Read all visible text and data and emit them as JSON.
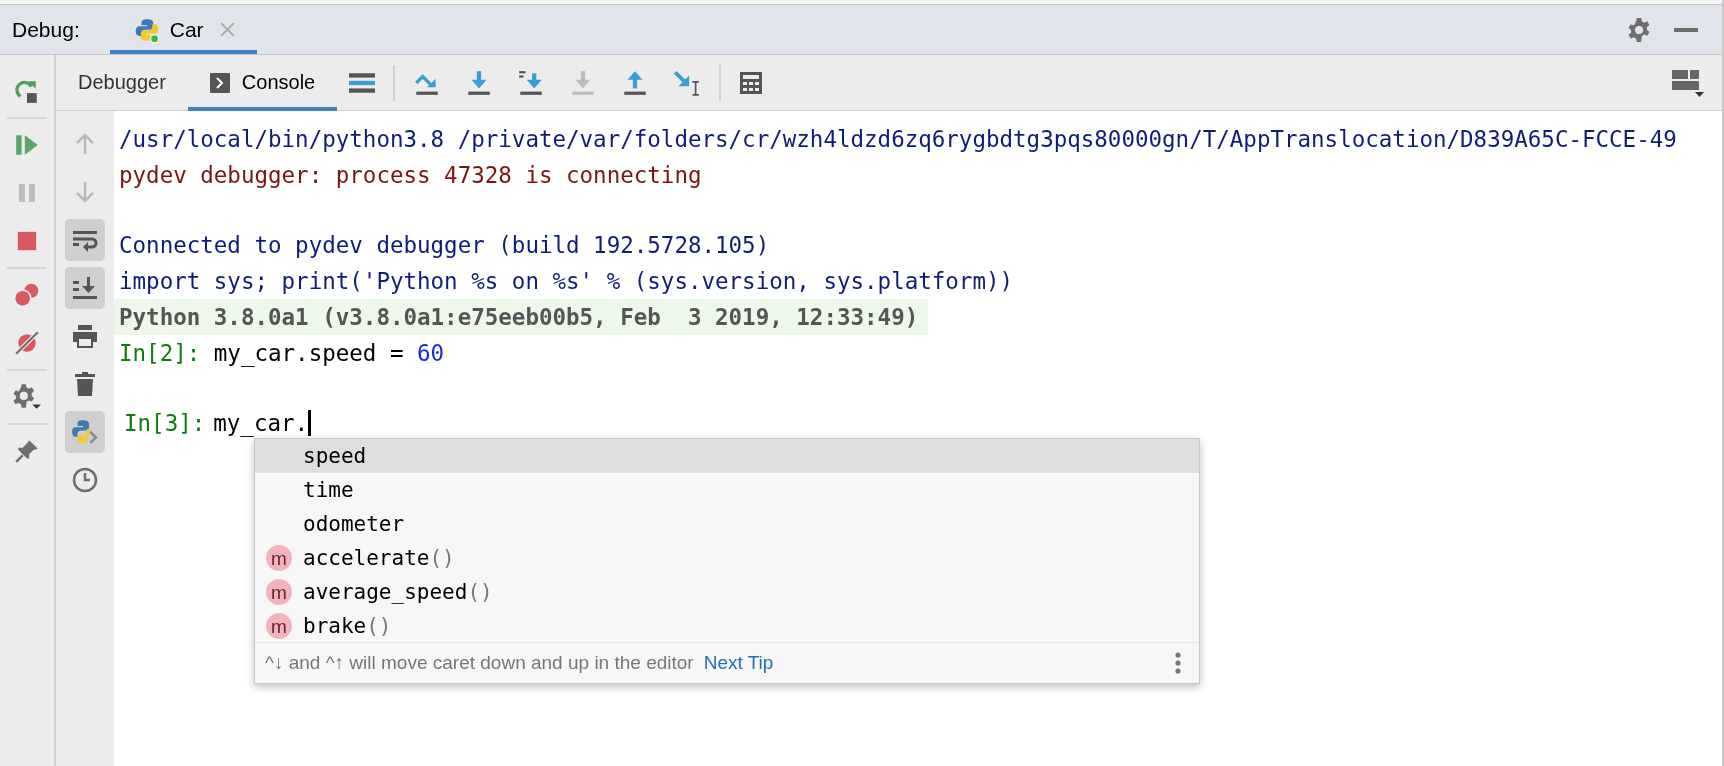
{
  "debug_bar": {
    "label": "Debug:",
    "tab": {
      "title": "Car",
      "selected": true
    }
  },
  "panel_tabs": [
    {
      "label": "Debugger",
      "kind": "plain",
      "selected": false
    },
    {
      "label": "Console",
      "kind": "console",
      "selected": true
    }
  ],
  "step_buttons": [
    {
      "kind": "step-over",
      "disabled": false
    },
    {
      "kind": "step-into",
      "disabled": false
    },
    {
      "kind": "step-into-my-code",
      "disabled": false
    },
    {
      "kind": "force-step-into",
      "disabled": true
    },
    {
      "kind": "step-out",
      "disabled": false
    },
    {
      "kind": "run-to-cursor",
      "disabled": false
    }
  ],
  "debug_tools": [
    {
      "kind": "rerun"
    },
    {
      "kind": "resume",
      "disabled": false
    },
    {
      "kind": "pause",
      "disabled": true
    },
    {
      "kind": "stop",
      "disabled": false
    },
    {
      "kind": "breakpoints"
    },
    {
      "kind": "mute"
    },
    {
      "kind": "settings"
    },
    {
      "kind": "pin"
    }
  ],
  "console_tools": [
    {
      "kind": "up",
      "on": false,
      "disabled": true
    },
    {
      "kind": "down",
      "on": false,
      "disabled": true
    },
    {
      "kind": "wrap",
      "on": true,
      "disabled": false
    },
    {
      "kind": "scroll-end",
      "on": true,
      "disabled": false
    },
    {
      "kind": "print",
      "on": false,
      "disabled": false
    },
    {
      "kind": "trash",
      "on": false,
      "disabled": false
    },
    {
      "kind": "python",
      "on": true,
      "disabled": false
    },
    {
      "kind": "history",
      "on": false,
      "disabled": false
    }
  ],
  "console": {
    "blocks": [
      {
        "lines": [
          {
            "highlighted": false,
            "segments": [
              {
                "text": "/usr/local/bin/python3.8 /private/var/folders/cr/wzh4ldzd6zq6rygbdtg3pqs80000gn/T/AppTranslocation/D839A65C-FCCE-49",
                "kind": "system"
              }
            ]
          },
          {
            "highlighted": false,
            "segments": [
              {
                "text": "pydev debugger: process 47328 is connecting",
                "kind": "stderr"
              }
            ]
          }
        ]
      },
      {
        "lines": [
          {
            "highlighted": false,
            "segments": [
              {
                "text": "Connected to pydev debugger (build 192.5728.105)",
                "kind": "system"
              }
            ]
          },
          {
            "highlighted": false,
            "segments": [
              {
                "text": "import sys; print('Python %s on %s' % (sys.version, sys.platform))",
                "kind": "system"
              }
            ]
          },
          {
            "highlighted": true,
            "segments": [
              {
                "text": "Python 3.8.0a1 (v3.8.0a1:e75eeb00b5, Feb  3 2019, 12:33:49)",
                "kind": "output"
              }
            ]
          },
          {
            "highlighted": false,
            "segments": [
              {
                "text": "In[2]:",
                "kind": "prompt"
              },
              {
                "text": " my_car.speed = ",
                "kind": "code"
              },
              {
                "text": "60",
                "kind": "number"
              }
            ]
          }
        ]
      }
    ],
    "input": {
      "prompt": "In[3]:",
      "value": "my_car."
    }
  },
  "completion": {
    "items": [
      {
        "label": "speed",
        "kind": "field",
        "selected": true
      },
      {
        "label": "time",
        "kind": "field",
        "selected": false
      },
      {
        "label": "odometer",
        "kind": "field",
        "selected": false
      },
      {
        "label": "accelerate",
        "suffix": "()",
        "badge": "m",
        "kind": "method",
        "selected": false
      },
      {
        "label": "average_speed",
        "suffix": "()",
        "badge": "m",
        "kind": "method",
        "selected": false
      },
      {
        "label": "brake",
        "suffix": "()",
        "badge": "m",
        "kind": "method",
        "selected": false
      }
    ],
    "hint": "^↓ and ^↑ will move caret down and up in the editor",
    "link": "Next Tip"
  }
}
